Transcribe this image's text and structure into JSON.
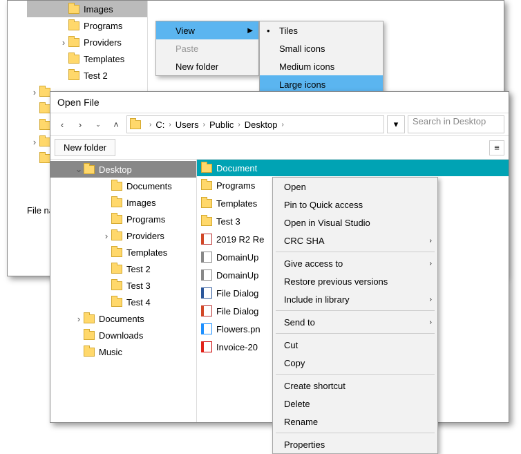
{
  "backTree": [
    {
      "label": "Images",
      "indent": 62,
      "sel": true,
      "exp": ""
    },
    {
      "label": "Programs",
      "indent": 62,
      "exp": ""
    },
    {
      "label": "Providers",
      "indent": 62,
      "exp": "›"
    },
    {
      "label": "Templates",
      "indent": 62,
      "exp": ""
    },
    {
      "label": "Test 2",
      "indent": 62,
      "exp": ""
    },
    {
      "label": "",
      "indent": 0,
      "exp": "›",
      "blank": true
    },
    {
      "label": "",
      "indent": 0,
      "exp": "",
      "blank": true
    },
    {
      "label": "",
      "indent": 0,
      "exp": "",
      "blank": true
    },
    {
      "label": "",
      "indent": 0,
      "exp": "›",
      "blank": true
    },
    {
      "label": "",
      "indent": 0,
      "exp": "",
      "blank": true
    }
  ],
  "backBottomLabel": "File nam",
  "viewMenu": {
    "items": [
      {
        "label": "View",
        "hi": true,
        "sub": true
      },
      {
        "label": "Paste",
        "dim": true
      },
      {
        "label": "New folder"
      }
    ],
    "subitems": [
      {
        "label": "Tiles",
        "bullet": true
      },
      {
        "label": "Small icons"
      },
      {
        "label": "Medium icons"
      },
      {
        "label": "Large icons",
        "hi": true
      }
    ]
  },
  "front": {
    "title": "Open File",
    "crumbs": [
      "C:",
      "Users",
      "Public",
      "Desktop"
    ],
    "searchPlaceholder": "Search in Desktop",
    "newFolder": "New folder",
    "tree": [
      {
        "label": "Desktop",
        "indent": 30,
        "exp": "⌄",
        "sel": true
      },
      {
        "label": "Documents",
        "indent": 70
      },
      {
        "label": "Images",
        "indent": 70
      },
      {
        "label": "Programs",
        "indent": 70
      },
      {
        "label": "Providers",
        "indent": 70,
        "exp": "›"
      },
      {
        "label": "Templates",
        "indent": 70
      },
      {
        "label": "Test 2",
        "indent": 70
      },
      {
        "label": "Test 3",
        "indent": 70
      },
      {
        "label": "Test 4",
        "indent": 70
      },
      {
        "label": "Documents",
        "indent": 30,
        "exp": "›"
      },
      {
        "label": "Downloads",
        "indent": 30
      },
      {
        "label": "Music",
        "indent": 30
      }
    ],
    "colHead": "Document",
    "files": [
      {
        "label": "Programs",
        "ic": "folder"
      },
      {
        "label": "Templates",
        "ic": "folder"
      },
      {
        "label": "Test 3",
        "ic": "folder"
      },
      {
        "label": "2019 R2 Re",
        "ic": "doc"
      },
      {
        "label": "DomainUp",
        "ic": "rtf"
      },
      {
        "label": "DomainUp",
        "ic": "rtf"
      },
      {
        "label": "File Dialog",
        "ic": "word"
      },
      {
        "label": "File Dialog",
        "ic": "doc"
      },
      {
        "label": "Flowers.pn",
        "ic": "img"
      },
      {
        "label": "Invoice-20",
        "ic": "pdf"
      }
    ]
  },
  "ctxMenu": [
    {
      "label": "Open"
    },
    {
      "label": "Pin to Quick access"
    },
    {
      "label": "Open in Visual Studio"
    },
    {
      "label": "CRC SHA",
      "sub": true
    },
    {
      "sep": true
    },
    {
      "label": "Give access to",
      "sub": true
    },
    {
      "label": "Restore previous versions"
    },
    {
      "label": "Include in library",
      "sub": true
    },
    {
      "sep": true
    },
    {
      "label": "Send to",
      "sub": true
    },
    {
      "sep": true
    },
    {
      "label": "Cut"
    },
    {
      "label": "Copy"
    },
    {
      "sep": true
    },
    {
      "label": "Create shortcut"
    },
    {
      "label": "Delete"
    },
    {
      "label": "Rename"
    },
    {
      "sep": true
    },
    {
      "label": "Properties"
    }
  ]
}
